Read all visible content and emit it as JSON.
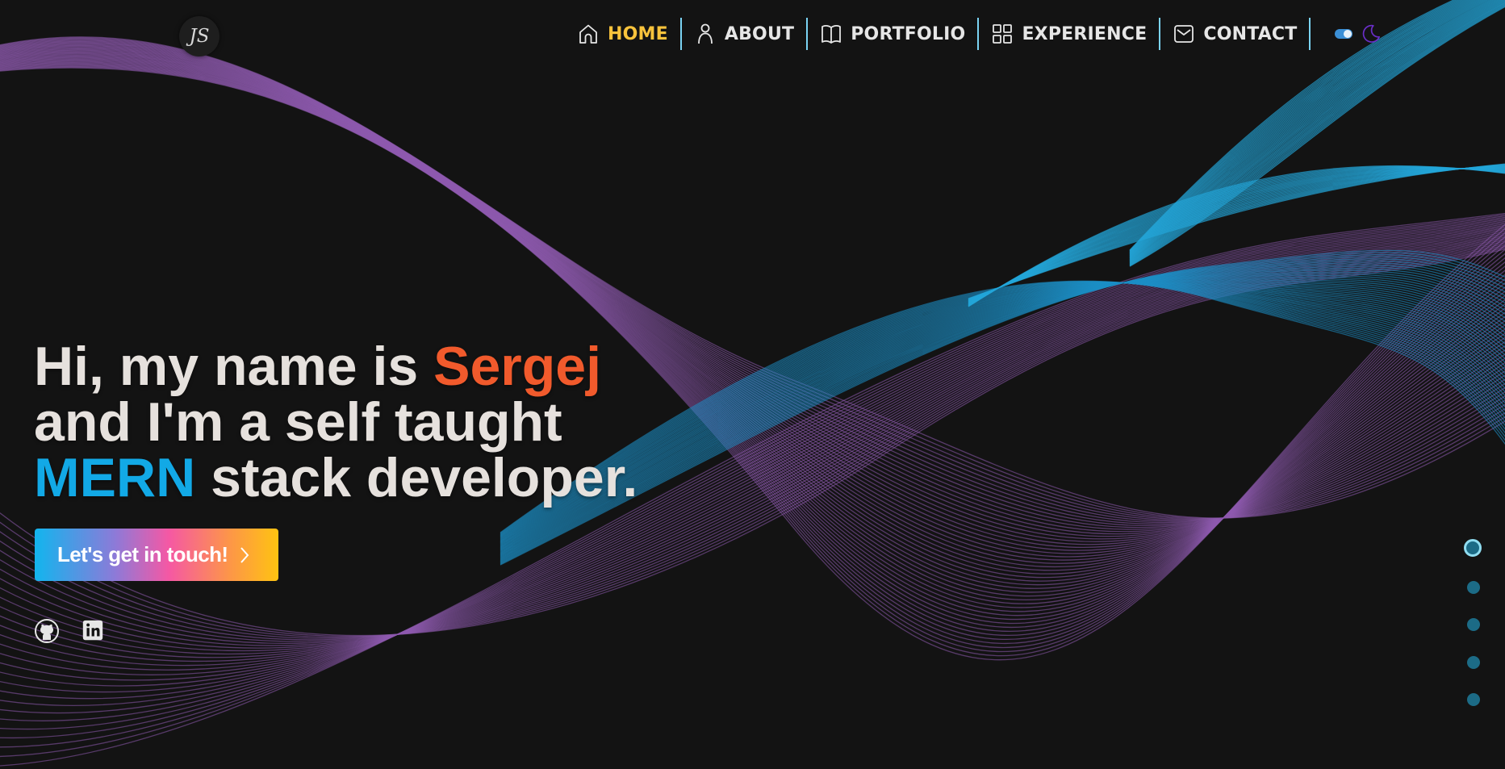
{
  "brand": {
    "logo_text": "JS"
  },
  "nav": {
    "items": [
      {
        "label": "HOME",
        "icon": "home-icon",
        "active": true
      },
      {
        "label": "ABOUT",
        "icon": "user-icon",
        "active": false
      },
      {
        "label": "PORTFOLIO",
        "icon": "book-icon",
        "active": false
      },
      {
        "label": "EXPERIENCE",
        "icon": "grid-icon",
        "active": false
      },
      {
        "label": "CONTACT",
        "icon": "mail-icon",
        "active": false
      }
    ],
    "theme_toggle": {
      "icons": [
        "toggle-icon",
        "moon-icon"
      ],
      "mode": "dark"
    }
  },
  "hero": {
    "line1_prefix": "Hi, my name is ",
    "line1_name": "Sergej",
    "line2": "and I'm a self taught",
    "line3_highlight": "MERN",
    "line3_suffix": " stack developer.",
    "cta_label": "Let's get in touch!"
  },
  "social": [
    {
      "icon": "github-icon"
    },
    {
      "icon": "linkedin-icon"
    }
  ],
  "section_dots": {
    "count": 5,
    "active_index": 0
  },
  "colors": {
    "background": "#131313",
    "accent_active_nav": "#f8c33c",
    "name_highlight": "#f15a2c",
    "stack_highlight": "#12a9e6",
    "nav_separator": "#7ad3f3",
    "dot": "#1c6b86",
    "dot_active_ring": "#8fdcf0"
  }
}
